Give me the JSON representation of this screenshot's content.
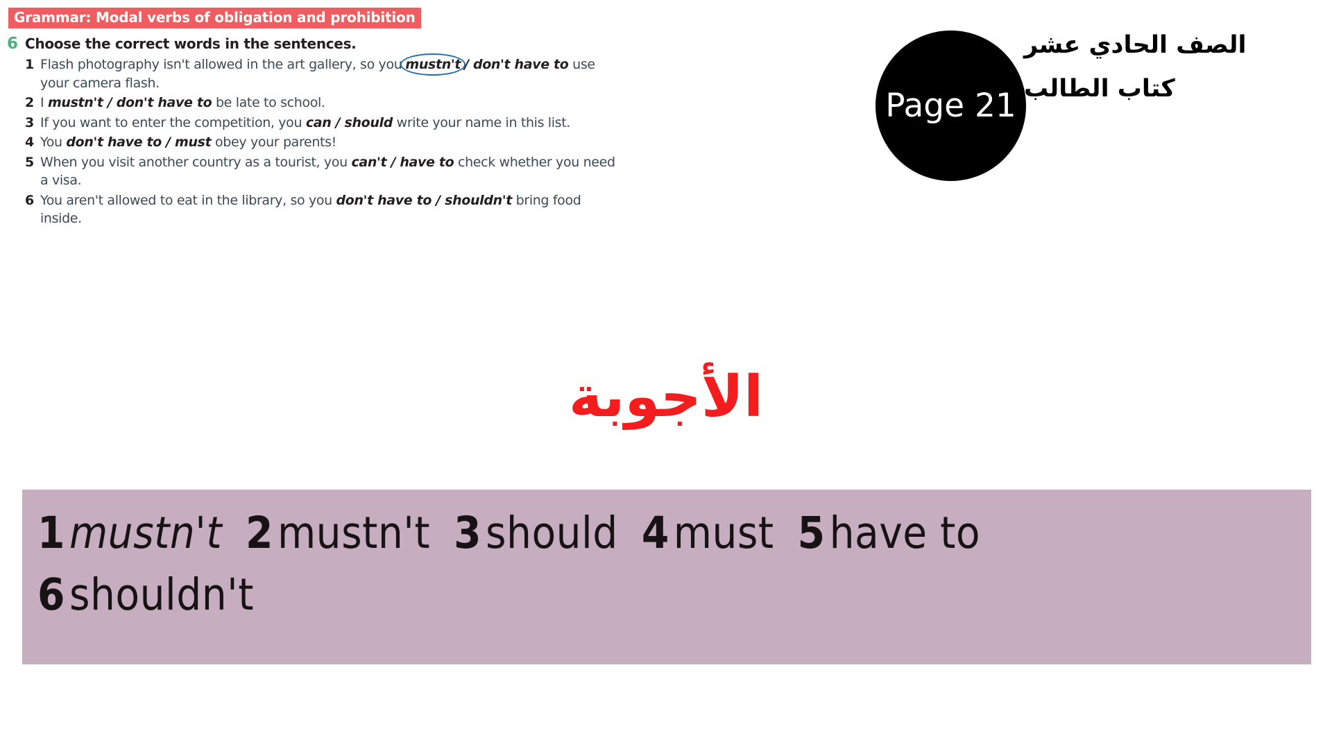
{
  "banner": {
    "title": "Grammar: Modal verbs of obligation and prohibition",
    "bg_color": "#ef5d60",
    "text_color": "#ffffff"
  },
  "exercise": {
    "number": "6",
    "number_color": "#4bb07b",
    "instruction": "Choose the correct words in the sentences.",
    "questions": [
      {
        "number": "1",
        "parts": [
          {
            "text": "Flash photography isn't allowed in the art gallery, so you",
            "style": "plain"
          },
          {
            "text": "mustn't",
            "style": "circled"
          },
          {
            "text": "/ don't have to",
            "style": "bold-italic"
          },
          {
            "text": " use your camera flash.",
            "style": "plain"
          }
        ]
      },
      {
        "number": "2",
        "parts": [
          {
            "text": "I ",
            "style": "plain"
          },
          {
            "text": "mustn't / don't have to",
            "style": "bold-italic"
          },
          {
            "text": " be late to school.",
            "style": "plain"
          }
        ]
      },
      {
        "number": "3",
        "parts": [
          {
            "text": "If you want to enter the competition, you ",
            "style": "plain"
          },
          {
            "text": "can / should",
            "style": "bold-italic"
          },
          {
            "text": " write your name in this list.",
            "style": "plain"
          }
        ]
      },
      {
        "number": "4",
        "parts": [
          {
            "text": "You ",
            "style": "plain"
          },
          {
            "text": "don't have to / must",
            "style": "bold-italic"
          },
          {
            "text": " obey your parents!",
            "style": "plain"
          }
        ]
      },
      {
        "number": "5",
        "parts": [
          {
            "text": "When you visit another country as a tourist, you ",
            "style": "plain"
          },
          {
            "text": "can't / have to",
            "style": "bold-italic"
          },
          {
            "text": " check whether you need a visa.",
            "style": "plain"
          }
        ]
      },
      {
        "number": "6",
        "parts": [
          {
            "text": "You aren't allowed to eat in the library, so you ",
            "style": "plain"
          },
          {
            "text": "don't have to / shouldn't",
            "style": "bold-italic"
          },
          {
            "text": " bring food inside.",
            "style": "plain"
          }
        ]
      }
    ]
  },
  "page_badge": {
    "label": "Page 21",
    "bg_color": "#000000",
    "text_color": "#ffffff"
  },
  "arabic_header": {
    "grade": "الصف الحادي عشر",
    "book": "كتاب الطالب"
  },
  "answers_title": {
    "text": "الأجوبة",
    "color": "#f41d1d"
  },
  "answer_box": {
    "bg_color": "#c6adc0",
    "lines": [
      [
        {
          "number": "1",
          "value": "mustn't",
          "italic": true
        },
        {
          "number": "2",
          "value": "mustn't",
          "italic": false
        },
        {
          "number": "3",
          "value": "should",
          "italic": false
        },
        {
          "number": "4",
          "value": "must",
          "italic": false
        },
        {
          "number": "5",
          "value": "have to",
          "italic": false
        }
      ],
      [
        {
          "number": "6",
          "value": "shouldn't",
          "italic": false
        }
      ]
    ]
  }
}
